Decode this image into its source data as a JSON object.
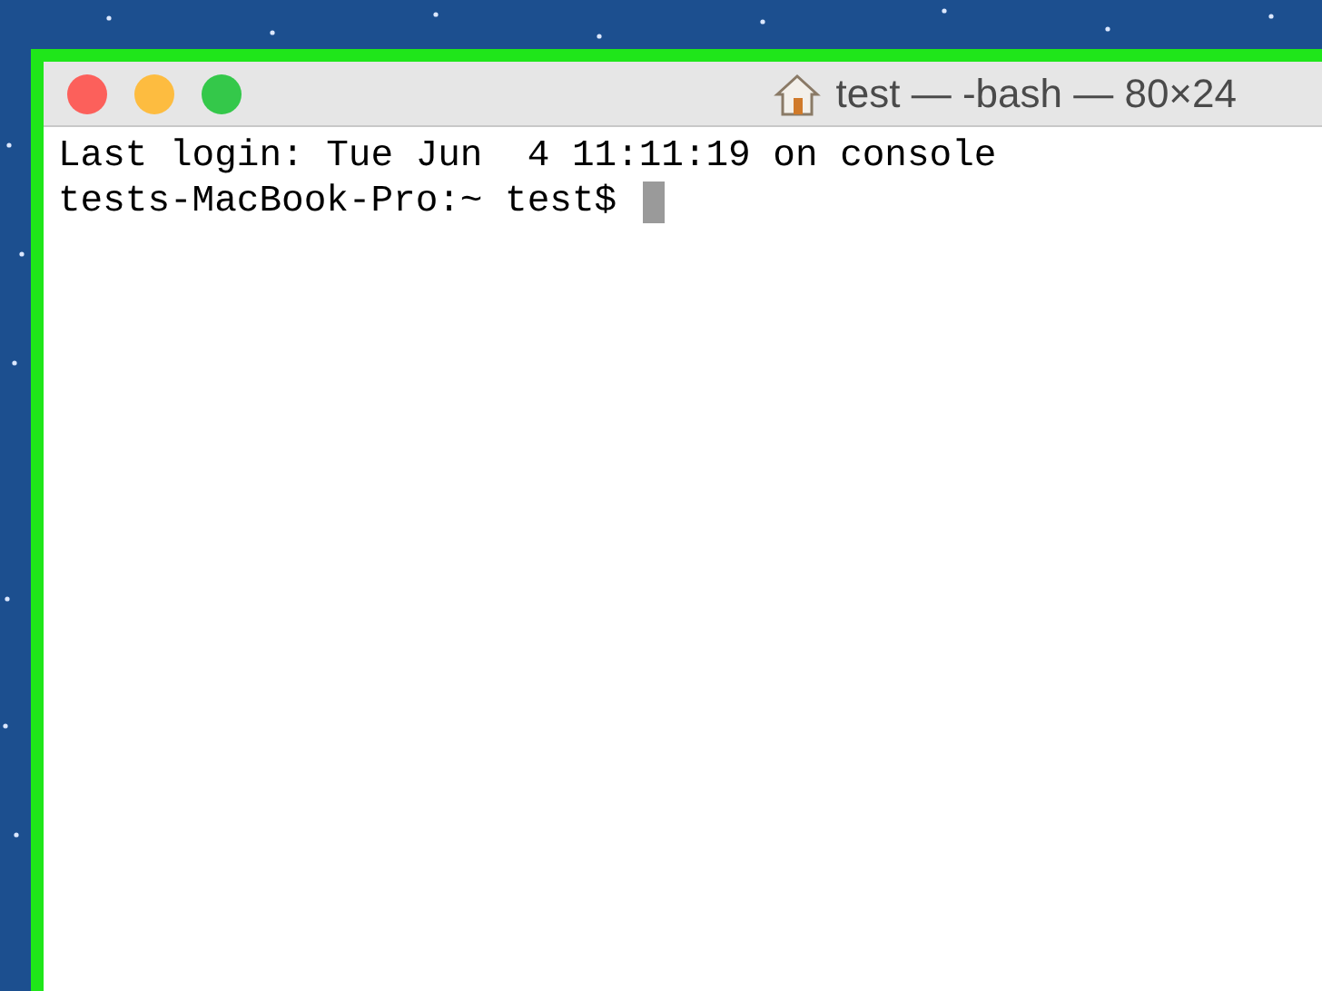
{
  "window": {
    "title": "test — -bash — 80×24",
    "buttons": [
      {
        "color": "#fc605b"
      },
      {
        "color": "#fdbc40"
      },
      {
        "color": "#34c84a"
      }
    ]
  },
  "terminal": {
    "lines": [
      "Last login: Tue Jun  4 11:11:19 on console",
      "tests-MacBook-Pro:~ test$"
    ],
    "cursor": true
  }
}
